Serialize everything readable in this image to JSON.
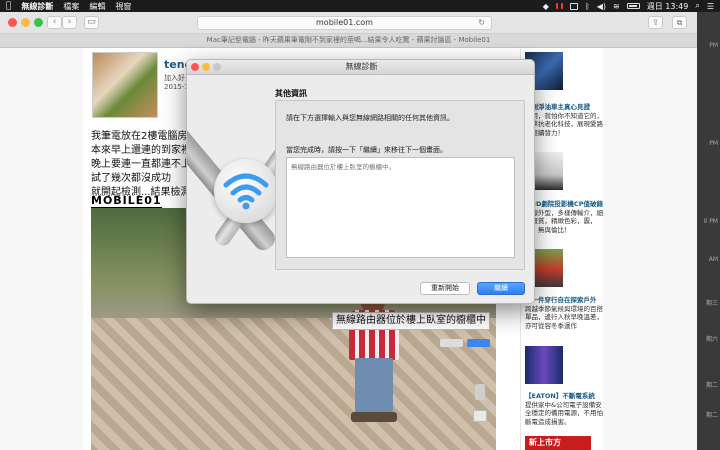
{
  "menubar": {
    "app": "無線診斷",
    "items": [
      "檔案",
      "編輯",
      "視窗"
    ],
    "clock": "週日 13:49"
  },
  "browser": {
    "url": "mobile01.com",
    "tab_title": "Mac筆記型電腦 - 昨天蘋果筆電剛不到家裡的莖喝...結果令人吃驚 - 蘋果討論區 - Mobile01"
  },
  "post": {
    "username": "teng",
    "joined": [
      "加入好",
      "2015-1"
    ],
    "lines": [
      "我筆電放在2樓電腦房",
      "本來早上還連的到家裡",
      "晚上要連一直都連不上",
      "試了幾次都沒成功",
      "就開起檢測...結果檢測"
    ],
    "logo_text": "MOBILE01",
    "photo_caption": "無線路由器位於樓上臥室的櫥櫃中"
  },
  "sidebar": {
    "ads": [
      {
        "head": "開測淨油車主真心見證",
        "body": "試用，就怕你不知道它的，引擎抗老化科技，展現愛路年輕續發力！"
      },
      {
        "head": "生3D劇院投影機CP值破錶",
        "body": "白線外型，多樣傳輸介，細膩畫質，精緻色彩，震，撼，無與倫比！"
      },
      {
        "head": "就一件穿行自在探索戶外",
        "body": "跨越季節氣候與環境的百搭單品，邊行入秋早晚溫差，亦可從容冬季運作"
      },
      {
        "head": "【EATON】不斷電系統",
        "body": "提供家中&公司電子設備安全穩定的備用電源，不用怕斷電造成損害。"
      }
    ],
    "footer": "新上市方"
  },
  "edge_labels": [
    "PM",
    "PM",
    "0 PM",
    "AM",
    "期三",
    "期六",
    "期二",
    "期二"
  ],
  "dialog": {
    "title": "無線診斷",
    "section_title": "其他資訊",
    "prompt1": "請在下方選擇輸入與您無線網路相關的任何其他資訊。",
    "prompt2": "當您完成時，請按一下「繼續」來移往下一個畫面。",
    "textarea_placeholder": "無線路由器位於樓上臥室的櫥櫃中。",
    "restart_label": "重新開始",
    "continue_label": "繼續"
  },
  "colors": {
    "accent": "#2f7ff0",
    "close": "#fc5753",
    "minimize": "#fdbc40",
    "zoom": "#33c748",
    "link": "#1b5d8a"
  },
  "icons": [
    "apple-icon",
    "wifi-icon",
    "bluetooth-icon",
    "volume-icon",
    "battery-icon",
    "search-icon",
    "menu-icon",
    "reload-icon",
    "share-icon",
    "tabs-icon",
    "back-icon",
    "forward-icon",
    "sidebar-icon"
  ]
}
